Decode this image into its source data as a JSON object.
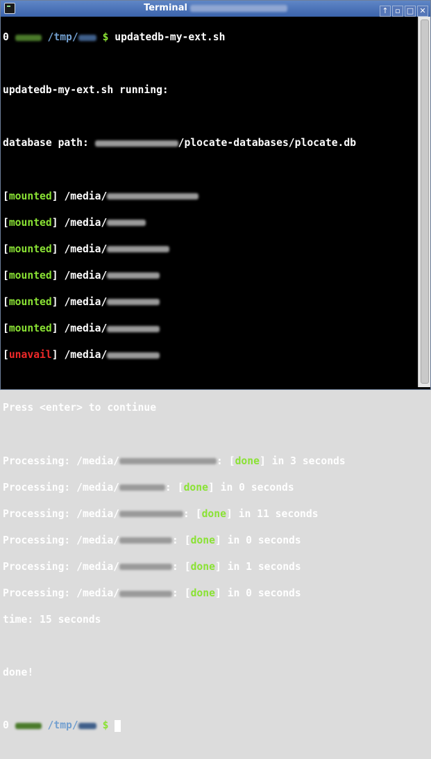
{
  "window": {
    "title": "Terminal",
    "buttons": {
      "up": "↑",
      "minimize": "▫",
      "maximize": "□",
      "close": "✕"
    }
  },
  "terminal": {
    "prompt_top": {
      "exit_code": "0",
      "path": "/tmp/",
      "symbol": "$",
      "command": "updatedb-my-ext.sh"
    },
    "running_line": "updatedb-my-ext.sh running:",
    "db_path_label": "database path:",
    "db_path_suffix": "/plocate-databases/plocate.db",
    "mounts": [
      {
        "status": "mounted",
        "path": "/media/"
      },
      {
        "status": "mounted",
        "path": "/media/"
      },
      {
        "status": "mounted",
        "path": "/media/"
      },
      {
        "status": "mounted",
        "path": "/media/"
      },
      {
        "status": "mounted",
        "path": "/media/"
      },
      {
        "status": "mounted",
        "path": "/media/"
      },
      {
        "status": "unavail",
        "path": "/media/"
      }
    ],
    "press_line": "Press <enter> to continue",
    "processing_label": "Processing:",
    "processing": [
      {
        "path": "/media/",
        "status": "done",
        "time": "3"
      },
      {
        "path": "/media/",
        "status": "done",
        "time": "0"
      },
      {
        "path": "/media/",
        "status": "done",
        "time": "11"
      },
      {
        "path": "/media/",
        "status": "done",
        "time": "0"
      },
      {
        "path": "/media/",
        "status": "done",
        "time": "1"
      },
      {
        "path": "/media/",
        "status": "done",
        "time": "0"
      }
    ],
    "time_line": "time: 15 seconds",
    "done_line": "done!",
    "prompt_bottom": {
      "exit_code": "0",
      "path": "/tmp/",
      "symbol": "$"
    }
  },
  "colors": {
    "green": "#8ae234",
    "red": "#ef2929",
    "blue": "#729fcf",
    "titlebar": "#4a72b8"
  }
}
